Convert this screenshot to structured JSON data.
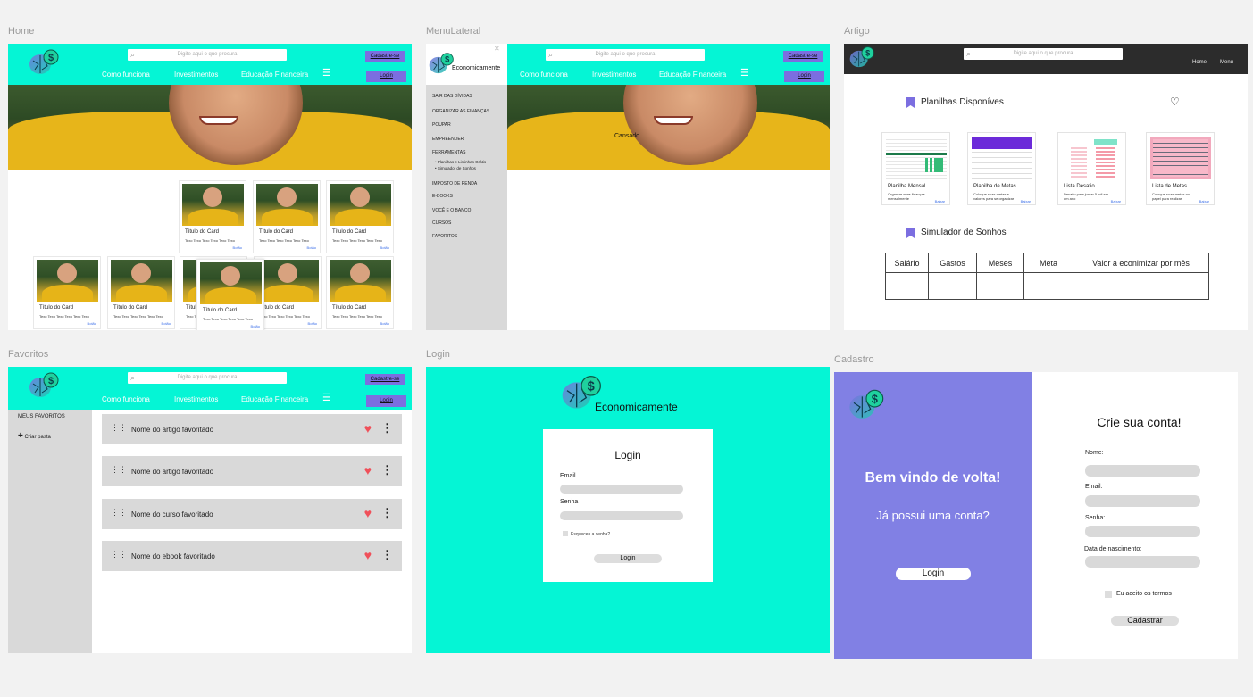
{
  "frames": {
    "home": "Home",
    "menu_lateral": "MenuLateral",
    "artigo": "Artigo",
    "favoritos": "Favoritos",
    "login": "Login",
    "cadastro": "Cadastro"
  },
  "header": {
    "search_placeholder": "Digite aqui o que procura",
    "signup": "Cadastre-se",
    "login": "Login",
    "nav": [
      "Como funciona",
      "Investimentos",
      "Educação Financeira"
    ]
  },
  "brand": "Economicamente",
  "cards": {
    "title": "Título do Card",
    "text": "Texo Texo Texo Texo Texo Texo",
    "button": "Botão"
  },
  "menu_lateral": {
    "items": [
      "SAIR DAS DÍVIDAS",
      "ORGANIZAR AS FINANÇAS",
      "POUPAR",
      "EMPREENDER",
      "FERRAMENTAS",
      "IMPOSTO DE RENDA",
      "E-BOOKS",
      "VOCÊ E O BANCO",
      "CURSOS",
      "FAVORITOS"
    ],
    "subitems": [
      "Planilhas e Listinhas Grátis",
      "Simulador de Sonhos"
    ],
    "hero_caption": "Cansado..."
  },
  "artigo": {
    "nav": [
      "Home",
      "Menu"
    ],
    "section1": "Planilhas Disponíves",
    "sheets": [
      {
        "title": "Planilha Mensal",
        "desc": "Organize suas finanças mensalmente",
        "button": "Baixar"
      },
      {
        "title": "Planilha de Metas",
        "desc": "Coloque suas metas e valores para se organizar",
        "button": "Baixar"
      },
      {
        "title": "Lista Desafio",
        "desc": "Desafio para juntar 5 mil em um ano",
        "button": "Baixar"
      },
      {
        "title": "Lista de Metas",
        "desc": "Coloque suas metas no papel para realizar",
        "button": "Baixar"
      }
    ],
    "section2": "Simulador de Sonhos",
    "table_headers": [
      "Salário",
      "Gastos",
      "Meses",
      "Meta",
      "Valor a econimizar por mês"
    ]
  },
  "favoritos": {
    "sidebar_title": "MEUS FAVORITOS",
    "create_folder": "Criar pasta",
    "items": [
      "Nome do artigo favoritado",
      "Nome do artigo favoritado",
      "Nome do curso favoritado",
      "Nome do ebook favoritado"
    ]
  },
  "login": {
    "title": "Login",
    "email": "Email",
    "password": "Senha",
    "forgot": "Esqueceu a senha?",
    "button": "Login"
  },
  "cadastro": {
    "welcome": "Bem vindo de volta!",
    "has_account": "Já possui uma conta?",
    "login_button": "Login",
    "title": "Crie sua conta!",
    "name": "Nome:",
    "email": "Email:",
    "password": "Senha:",
    "birth": "Data de nascimento:",
    "terms": "Eu aceito os termos",
    "submit": "Cadastrar"
  },
  "colors": {
    "teal": "#05f5d5",
    "purple": "#7b6ee0",
    "cadastro_purple": "#8180e4",
    "heart": "#f0505a"
  }
}
